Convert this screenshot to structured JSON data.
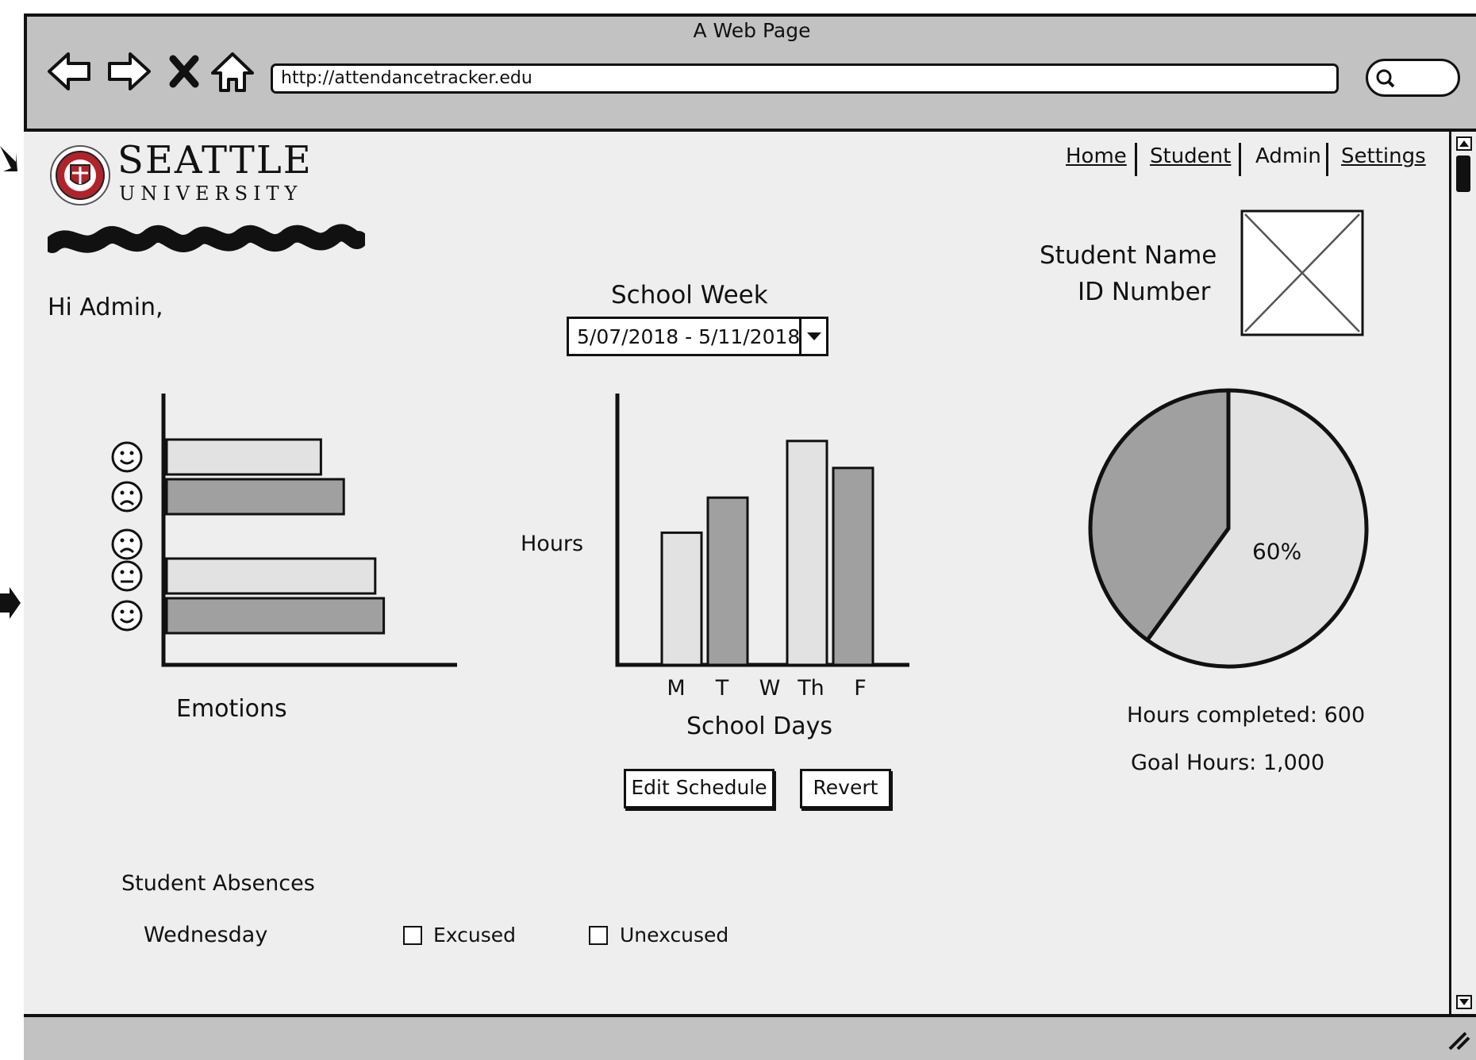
{
  "browser": {
    "title": "A Web Page",
    "url": "http://attendancetracker.edu",
    "nav_icons": [
      "back-arrow-icon",
      "forward-arrow-icon",
      "stop-x-icon",
      "home-icon"
    ],
    "search_icon": "search-icon"
  },
  "header": {
    "logo_line1": "SEATTLE",
    "logo_line2": "UNIVERSITY",
    "nav": [
      "Home",
      "Student",
      "Admin",
      "Settings"
    ]
  },
  "greeting": "Hi Admin,",
  "profile": {
    "name_label": "Student Name",
    "id_label": "ID Number"
  },
  "week_selector": {
    "label": "School Week",
    "value": "5/07/2018 - 5/11/2018"
  },
  "emotions_chart": {
    "xlabel": "Emotions"
  },
  "hours_chart": {
    "ylabel": "Hours",
    "xlabel": "School Days"
  },
  "pie": {
    "label": "60%",
    "hours_completed": "Hours completed: 600",
    "goal_hours": "Goal Hours: 1,000"
  },
  "buttons": {
    "edit_schedule": "Edit Schedule",
    "revert": "Revert"
  },
  "absences": {
    "title": "Student Absences",
    "day": "Wednesday",
    "excused": "Excused",
    "unexcused": "Unexcused"
  },
  "colors": {
    "light_bar": "#e2e2e2",
    "dark_bar": "#a0a0a0",
    "chrome": "#c2c2c2",
    "page_bg": "#eeeeee"
  },
  "chart_data": [
    {
      "type": "bar",
      "orientation": "horizontal",
      "categories": [
        "smile",
        "frown",
        "frown",
        "neutral",
        "smile"
      ],
      "values": [
        5.4,
        6.2,
        0,
        7.3,
        7.6
      ],
      "bar_shades": [
        "light",
        "dark",
        "light",
        "light",
        "dark"
      ],
      "xlabel": "Emotions",
      "ylabel": "",
      "xlim": [
        0,
        10
      ]
    },
    {
      "type": "bar",
      "categories": [
        "M",
        "T",
        "W",
        "Th",
        "F"
      ],
      "values": [
        4.9,
        6.2,
        0,
        8.3,
        7.3
      ],
      "bar_shades": [
        "light",
        "dark",
        "light",
        "light",
        "dark"
      ],
      "xlabel": "School Days",
      "ylabel": "Hours",
      "ylim": [
        0,
        10
      ]
    },
    {
      "type": "pie",
      "slices": [
        {
          "label": "60%",
          "value": 60,
          "shade": "light"
        },
        {
          "label": "",
          "value": 40,
          "shade": "dark"
        }
      ]
    }
  ]
}
